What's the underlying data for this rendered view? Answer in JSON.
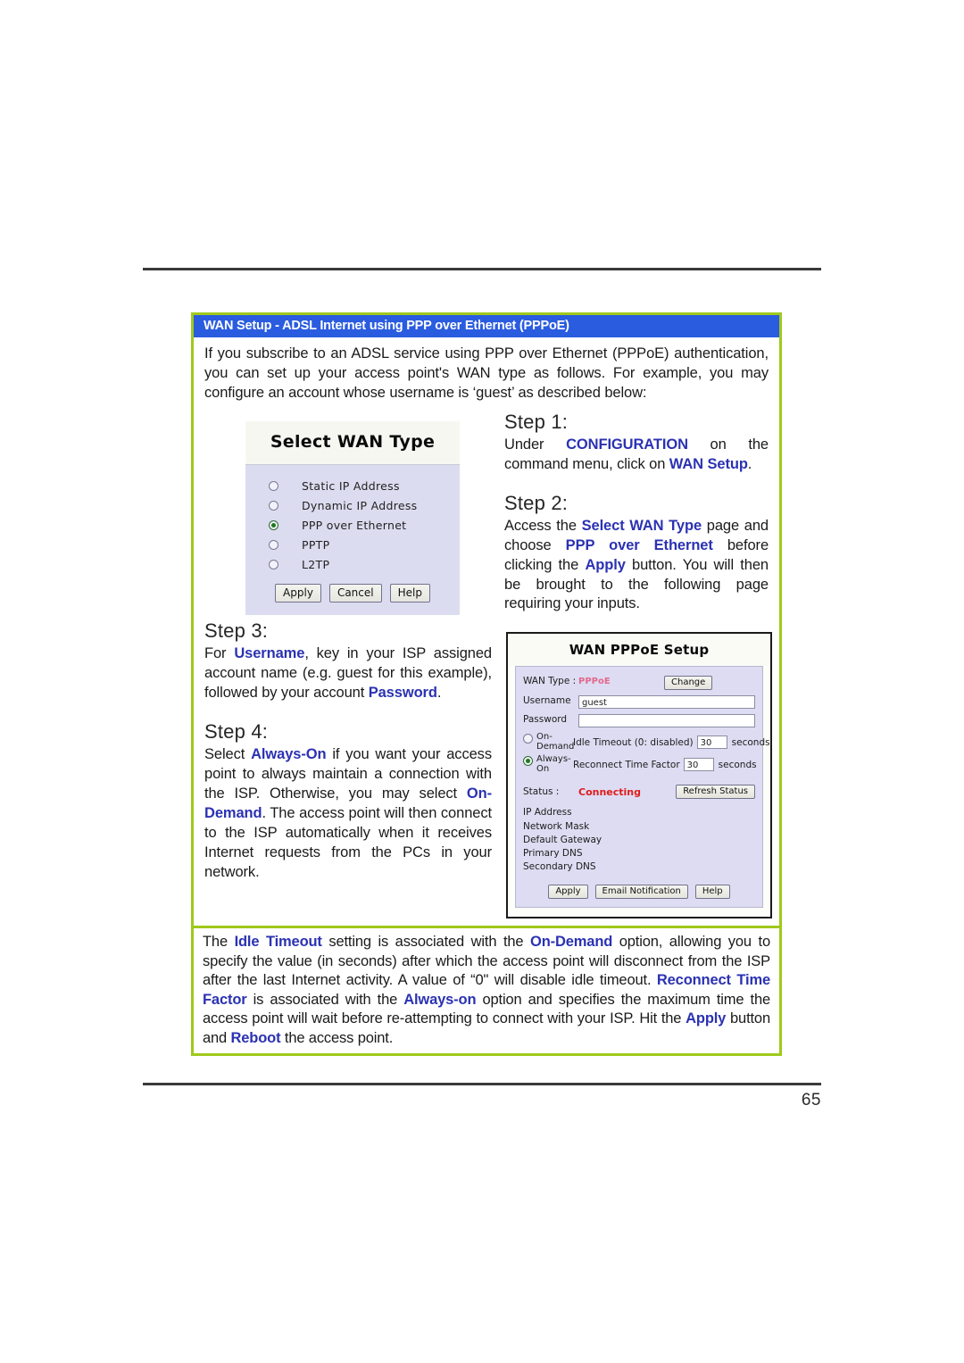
{
  "page": {
    "number": "65"
  },
  "box": {
    "title": "WAN Setup - ADSL Internet using PPP over Ethernet (PPPoE)",
    "intro": "If you subscribe to an ADSL service using PPP over Ethernet (PPPoE) authentication, you can set up your access point's WAN type as follows. For example, you may configure an account whose username is ‘guest’ as described below:"
  },
  "steps": {
    "step1": {
      "heading": "Step 1:",
      "t1": "Under ",
      "b1": "CONFIGURATION",
      "t2": " on the command menu, click on ",
      "b2": "WAN Setup",
      "t3": "."
    },
    "step2": {
      "heading": "Step 2:",
      "t1": "Access the ",
      "b1": "Select WAN Type",
      "t2": " page and choose ",
      "b2": "PPP over Ethernet",
      "t3": " before clicking the ",
      "b3": "Apply",
      "t4": " button.  You will then be brought to the following page requiring your inputs."
    },
    "step3": {
      "heading": "Step 3:",
      "t1": "For ",
      "b1": "Username",
      "t2": ", key in your ISP assigned account name (e.g. guest for this example), followed by your account ",
      "b2": "Password",
      "t3": "."
    },
    "step4": {
      "heading": "Step 4:",
      "t1": "Select ",
      "b1": "Always-On",
      "t2": " if you want your access point to always maintain a connection with the ISP. Otherwise, you may select ",
      "b2": "On-Demand",
      "t3": ". The access point will then connect to the ISP automatically when it receives Internet requests from the PCs in your network."
    }
  },
  "note": {
    "t1": "The ",
    "b1": "Idle Timeout",
    "t2": " setting is associated with the ",
    "b2": "On-Demand",
    "t3": " option, allowing you to specify the value (in seconds) after which the access point will disconnect from the ISP after the last Internet activity. A value of “0\" will disable idle timeout. ",
    "b3": "Reconnect Time Factor",
    "t4": " is associated with the ",
    "b4": "Always-on",
    "t5": " option and specifies the maximum time the access point will wait before re-attempting to connect with your ISP. Hit the ",
    "b5": "Apply",
    "t6": " button and ",
    "b6": "Reboot",
    "t7": " the access point."
  },
  "wan_type_screenshot": {
    "title": "Select WAN Type",
    "options": [
      {
        "label": "Static IP Address",
        "selected": false
      },
      {
        "label": "Dynamic IP Address",
        "selected": false
      },
      {
        "label": "PPP over Ethernet",
        "selected": true
      },
      {
        "label": "PPTP",
        "selected": false
      },
      {
        "label": "L2TP",
        "selected": false
      }
    ],
    "buttons": [
      "Apply",
      "Cancel",
      "Help"
    ]
  },
  "pppoe_screenshot": {
    "title": "WAN PPPoE Setup",
    "wan_type_label": "WAN Type :",
    "wan_type_value": "PPPoE",
    "change_button": "Change",
    "username_label": "Username",
    "username_value": "guest",
    "password_label": "Password",
    "password_value": "",
    "on_demand_label": "On-Demand",
    "on_demand_selected": false,
    "always_on_label": "Always-On",
    "always_on_selected": true,
    "idle_timeout_label": "Idle Timeout (0: disabled)",
    "idle_timeout_value": "30",
    "idle_timeout_units": "seconds",
    "reconnect_label": "Reconnect Time Factor",
    "reconnect_value": "30",
    "reconnect_units": "seconds",
    "status_label": "Status :",
    "status_value": "Connecting",
    "refresh_button": "Refresh Status",
    "readonly_fields": [
      "IP Address",
      "Network Mask",
      "Default Gateway",
      "Primary DNS",
      "Secondary DNS"
    ],
    "buttons": [
      "Apply",
      "Email Notification",
      "Help"
    ]
  },
  "colors": {
    "box_border": "#9fc91b",
    "title_bar": "#2a5ce0",
    "highlight_text": "#2b32b2",
    "status_red": "#e01b1b",
    "wan_type_pink": "#e26a8d",
    "panel_lavender": "#dddcf2",
    "rule": "#3a3a3a"
  }
}
